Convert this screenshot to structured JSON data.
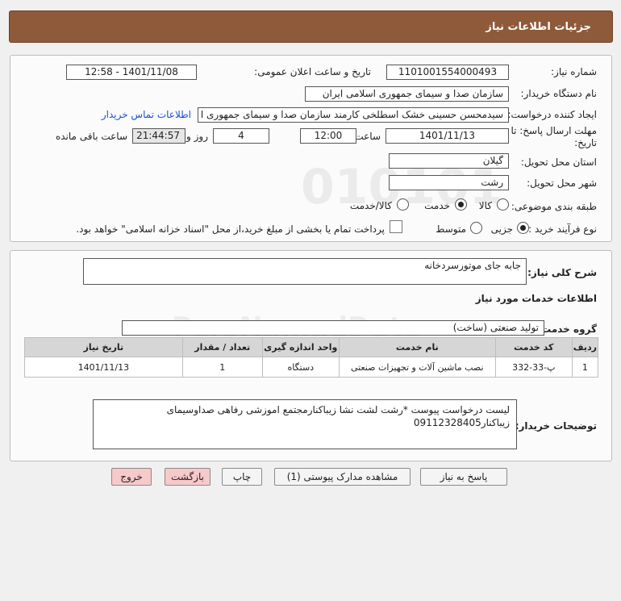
{
  "header": {
    "title": "جزئیات اطلاعات نیاز"
  },
  "details": {
    "need_number_label": "شماره نیاز:",
    "need_number": "1101001554000493",
    "announce_label": "تاریخ و ساعت اعلان عمومی:",
    "announce_value": "1401/11/08 - 12:58",
    "buyer_org_label": "نام دستگاه خریدار:",
    "buyer_org": "سازمان صدا و سیمای جمهوری اسلامی ایران",
    "requester_label": "ایجاد کننده درخواست:",
    "requester": "سیدمحسن حسینی خشک اسطلخی کارمند سازمان صدا و سیمای جمهوری ا",
    "contact_link": "اطلاعات تماس خریدار",
    "deadline_label_1": "مهلت ارسال پاسخ: تا",
    "deadline_label_2": "تاریخ:",
    "deadline_date": "1401/11/13",
    "time_label": "ساعت",
    "deadline_time": "12:00",
    "days_value": "4",
    "days_label": "روز و",
    "remaining_time": "21:44:57",
    "remaining_label": "ساعت باقی مانده",
    "province_label": "استان محل تحویل:",
    "province": "گیلان",
    "city_label": "شهر محل تحویل:",
    "city": "رشت",
    "category_label": "طبقه بندی موضوعی:",
    "category_options": [
      "کالا",
      "خدمت",
      "کالا/خدمت"
    ],
    "process_label": "نوع فرآیند خرید :",
    "process_options": [
      "جزیی",
      "متوسط"
    ],
    "payment_note": "پرداخت تمام یا بخشی از مبلغ خرید،از محل \"اسناد خزانه اسلامی\" خواهد بود."
  },
  "services": {
    "summary_label": "شرح کلی نیاز:",
    "summary": "جابه جای موتورسردخانه",
    "info_title": "اطلاعات خدمات مورد نیاز",
    "group_label": "گروه خدمت:",
    "group_value": "تولید صنعتی (ساخت)",
    "table": {
      "headers": [
        "ردیف",
        "کد خدمت",
        "نام خدمت",
        "واحد اندازه گیری",
        "تعداد / مقدار",
        "تاریخ نیاز"
      ],
      "rows": [
        [
          "1",
          "پ-33-332",
          "نصب ماشین آلات و تجهیزات صنعتی",
          "دستگاه",
          "1",
          "1401/11/13"
        ]
      ]
    },
    "buyer_desc_label": "توضیحات خریدار:",
    "buyer_desc": "لیست درخواست پیوست *رشت لشت نشا زیباکنارمجتمع اموزشی رفاهی صداوسیمای زیباکنار09112328405"
  },
  "buttons": {
    "reply": "پاسخ به نیاز",
    "attachments": "مشاهده مدارک پیوستی (1)",
    "print": "چاپ",
    "back": "بازگشت",
    "exit": "خروج"
  },
  "colors": {
    "header_bg": "#8e5a3a",
    "link": "#1a4fd6",
    "pink_button": "#f7c9c9"
  }
}
